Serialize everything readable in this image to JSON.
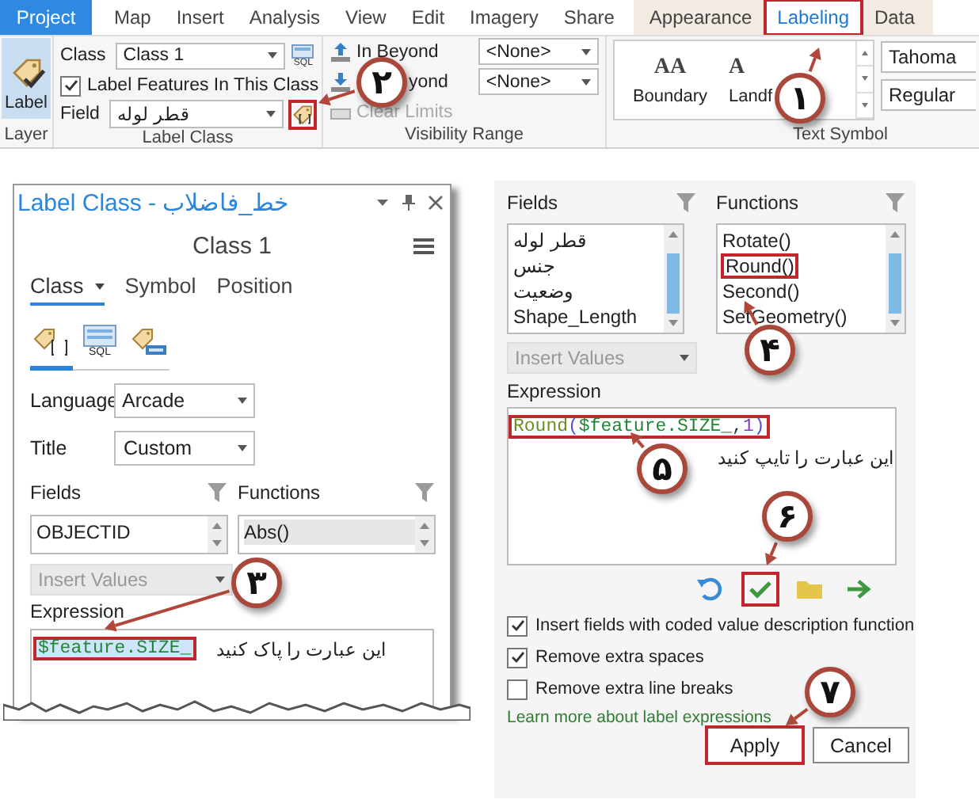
{
  "ribbon": {
    "tabs": [
      {
        "label": "Project",
        "kind": "file",
        "selected": false,
        "highlighted": false
      },
      {
        "label": "Map",
        "kind": "core",
        "selected": false,
        "highlighted": false
      },
      {
        "label": "Insert",
        "kind": "core",
        "selected": false,
        "highlighted": false
      },
      {
        "label": "Analysis",
        "kind": "core",
        "selected": false,
        "highlighted": false
      },
      {
        "label": "View",
        "kind": "core",
        "selected": false,
        "highlighted": false
      },
      {
        "label": "Edit",
        "kind": "core",
        "selected": false,
        "highlighted": false
      },
      {
        "label": "Imagery",
        "kind": "core",
        "selected": false,
        "highlighted": false
      },
      {
        "label": "Share",
        "kind": "core",
        "selected": false,
        "highlighted": false
      },
      {
        "label": "Appearance",
        "kind": "contextual",
        "selected": false,
        "highlighted": false
      },
      {
        "label": "Labeling",
        "kind": "contextual",
        "selected": true,
        "highlighted": true
      },
      {
        "label": "Data",
        "kind": "contextual",
        "selected": false,
        "highlighted": false
      }
    ],
    "layer_group": {
      "button": "Label",
      "selected": true,
      "caption": "Layer"
    },
    "label_class_group": {
      "class_label": "Class",
      "class_value": "Class 1",
      "sql_text": "SQL",
      "label_features": {
        "label": "Label Features In This Class",
        "checked": true
      },
      "field_label": "Field",
      "field_value": "قطر لوله",
      "expression_button": {
        "highlighted": true
      },
      "caption": "Label Class"
    },
    "visibility_group": {
      "items": [
        {
          "label": "In Beyond",
          "kind": "in",
          "disabled": false
        },
        {
          "label": "yond",
          "kind": "out",
          "disabled": false
        },
        {
          "label": "Clear Limits",
          "kind": "clear",
          "disabled": true
        }
      ],
      "dropdowns": [
        "<None>",
        "<None>"
      ],
      "caption": "Visibility Range"
    },
    "text_symbol_group": {
      "styles": [
        {
          "preview": "AA",
          "label": "Boundary"
        },
        {
          "preview": "A",
          "label": "Landf"
        }
      ],
      "font": "Tahoma",
      "font_style": "Regular",
      "caption": "Text Symbol"
    }
  },
  "left_panel": {
    "title": "Label Class - خط_فاضلاب",
    "class_name": "Class 1",
    "tabs": [
      {
        "label": "Class",
        "selected": true,
        "has_menu": true
      },
      {
        "label": "Symbol",
        "selected": false,
        "has_menu": false
      },
      {
        "label": "Position",
        "selected": false,
        "has_menu": false
      }
    ],
    "modes": [
      {
        "kind": "expression",
        "selected": true
      },
      {
        "kind": "sql",
        "text": "SQL",
        "selected": false
      },
      {
        "kind": "label_class",
        "selected": false
      }
    ],
    "language": {
      "label": "Language",
      "value": "Arcade"
    },
    "title_field": {
      "label": "Title",
      "value": "Custom"
    },
    "fields_label": "Fields",
    "functions_label": "Functions",
    "fields": [
      {
        "name": "OBJECTID",
        "selected": false
      }
    ],
    "functions": [
      {
        "name": "Abs()",
        "selected": true,
        "highlighted": false
      }
    ],
    "insert_values": {
      "label": "Insert Values",
      "disabled": true
    },
    "expression_label": "Expression",
    "expression": {
      "lines": [
        [
          {
            "text": "$feature.SIZE_",
            "kind": "field"
          }
        ]
      ],
      "selected": true,
      "highlighted": true
    },
    "note": "این عبارت را پاک کنید"
  },
  "right_panel": {
    "fields_label": "Fields",
    "functions_label": "Functions",
    "fields": [
      {
        "name": "قطر لوله",
        "selected": false
      },
      {
        "name": "جنس",
        "selected": false
      },
      {
        "name": "وضعیت",
        "selected": false
      },
      {
        "name": "Shape_Length",
        "selected": false
      }
    ],
    "functions": [
      {
        "name": "Rotate()",
        "selected": false,
        "highlighted": false
      },
      {
        "name": "Round()",
        "selected": false,
        "highlighted": true
      },
      {
        "name": "Second()",
        "selected": false,
        "highlighted": false
      },
      {
        "name": "SetGeometry()",
        "selected": false,
        "highlighted": false
      }
    ],
    "insert_values": {
      "label": "Insert Values",
      "disabled": true
    },
    "expression_label": "Expression",
    "expression": {
      "lines": [
        [
          {
            "text": "Round",
            "kind": "function"
          },
          {
            "text": "(",
            "kind": "paren"
          },
          {
            "text": "$feature.SIZE_",
            "kind": "field"
          },
          {
            "text": ",",
            "kind": "punct"
          },
          {
            "text": "1",
            "kind": "number"
          },
          {
            "text": ")",
            "kind": "paren"
          }
        ]
      ],
      "selected": false,
      "highlighted": true
    },
    "note": "این عبارت را تایپ کنید",
    "toolbar": [
      {
        "kind": "undo",
        "highlighted": false
      },
      {
        "kind": "verify",
        "highlighted": true
      },
      {
        "kind": "open",
        "highlighted": false
      },
      {
        "kind": "forward",
        "highlighted": false
      }
    ],
    "options": [
      {
        "label": "Insert fields with coded value description function",
        "checked": true
      },
      {
        "label": "Remove extra spaces",
        "checked": true
      },
      {
        "label": "Remove extra line breaks",
        "checked": false
      }
    ],
    "link": "Learn more about label expressions",
    "buttons": [
      {
        "label": "Apply",
        "highlighted": true
      },
      {
        "label": "Cancel",
        "highlighted": false
      }
    ]
  },
  "callouts": [
    {
      "number": "۱"
    },
    {
      "number": "۲"
    },
    {
      "number": "۳"
    },
    {
      "number": "۴"
    },
    {
      "number": "۵"
    },
    {
      "number": "۶"
    },
    {
      "number": "۷"
    }
  ]
}
